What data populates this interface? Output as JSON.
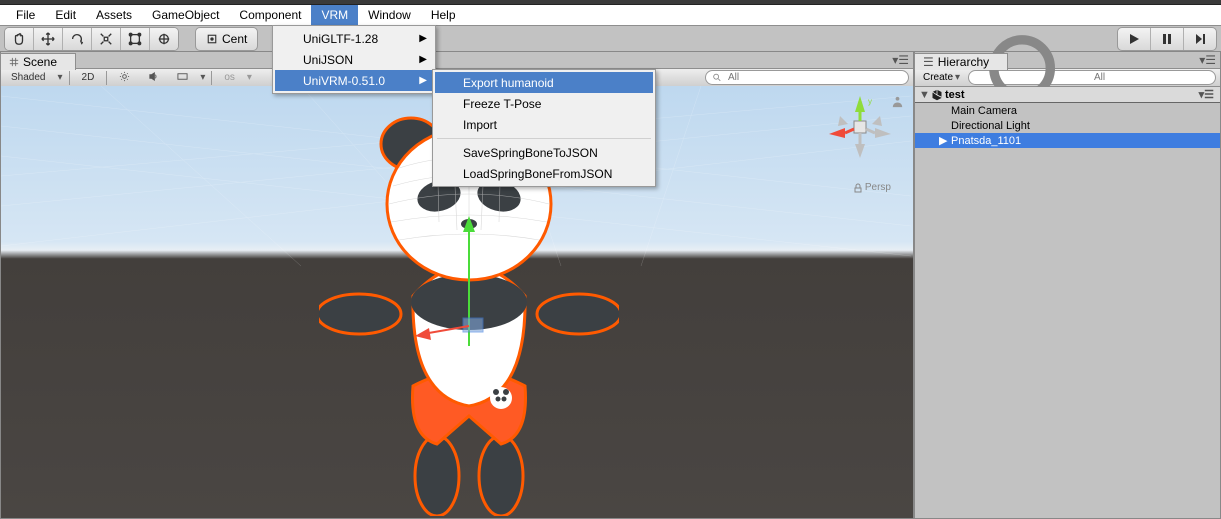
{
  "menubar": {
    "items": [
      "File",
      "Edit",
      "Assets",
      "GameObject",
      "Component",
      "VRM",
      "Window",
      "Help"
    ],
    "open": "VRM"
  },
  "toolbar": {
    "center_label": "Cent"
  },
  "scene_tab": {
    "label": "Scene"
  },
  "scene_toolbar": {
    "shading": "Shaded",
    "mode_2d": "2D",
    "gizmos_label": "Gizmos",
    "search_placeholder": "All"
  },
  "viewport": {
    "persp_label": "Persp",
    "axis_y": "y"
  },
  "hierarchy": {
    "tab_label": "Hierarchy",
    "create_label": "Create",
    "search_placeholder": "All",
    "root": "test",
    "items": [
      "Main Camera",
      "Directional Light",
      "Pnatsda_1101"
    ],
    "selected": "Pnatsda_1101"
  },
  "vrm_menu": {
    "items": [
      {
        "label": "UniGLTF-1.28",
        "submenu": true
      },
      {
        "label": "UniJSON",
        "submenu": true
      },
      {
        "label": "UniVRM-0.51.0",
        "submenu": true,
        "hover": true
      }
    ]
  },
  "univrm_submenu": {
    "items_top": [
      {
        "label": "Export humanoid",
        "hover": true
      },
      {
        "label": "Freeze T-Pose"
      },
      {
        "label": "Import"
      }
    ],
    "items_bottom": [
      {
        "label": "SaveSpringBoneToJSON"
      },
      {
        "label": "LoadSpringBoneFromJSON"
      }
    ]
  }
}
